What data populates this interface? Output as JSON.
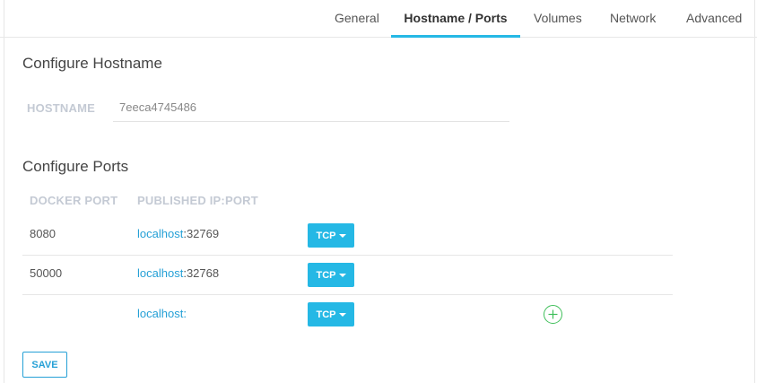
{
  "tabs": [
    {
      "label": "General",
      "active": false
    },
    {
      "label": "Hostname / Ports",
      "active": true
    },
    {
      "label": "Volumes",
      "active": false
    },
    {
      "label": "Network",
      "active": false
    },
    {
      "label": "Advanced",
      "active": false
    }
  ],
  "hostname_section": {
    "title": "Configure Hostname",
    "field_label": "HOSTNAME",
    "value": "7eeca4745486"
  },
  "ports_section": {
    "title": "Configure Ports",
    "headers": {
      "docker_port": "DOCKER PORT",
      "published": "PUBLISHED IP:PORT"
    },
    "rows": [
      {
        "docker_port": "8080",
        "host": "localhost",
        "separator": ":",
        "published_port": "32769",
        "protocol": "TCP"
      },
      {
        "docker_port": "50000",
        "host": "localhost",
        "separator": ":",
        "published_port": "32768",
        "protocol": "TCP"
      },
      {
        "docker_port": "",
        "host": "localhost",
        "separator": ":",
        "published_port": "",
        "protocol": "TCP"
      }
    ]
  },
  "save_label": "SAVE",
  "colors": {
    "accent": "#25b8e5",
    "link": "#25a0d6",
    "add": "#3fbf5a"
  },
  "icons": {
    "add": "plus-circle-icon",
    "dropdown": "caret-down-icon"
  }
}
